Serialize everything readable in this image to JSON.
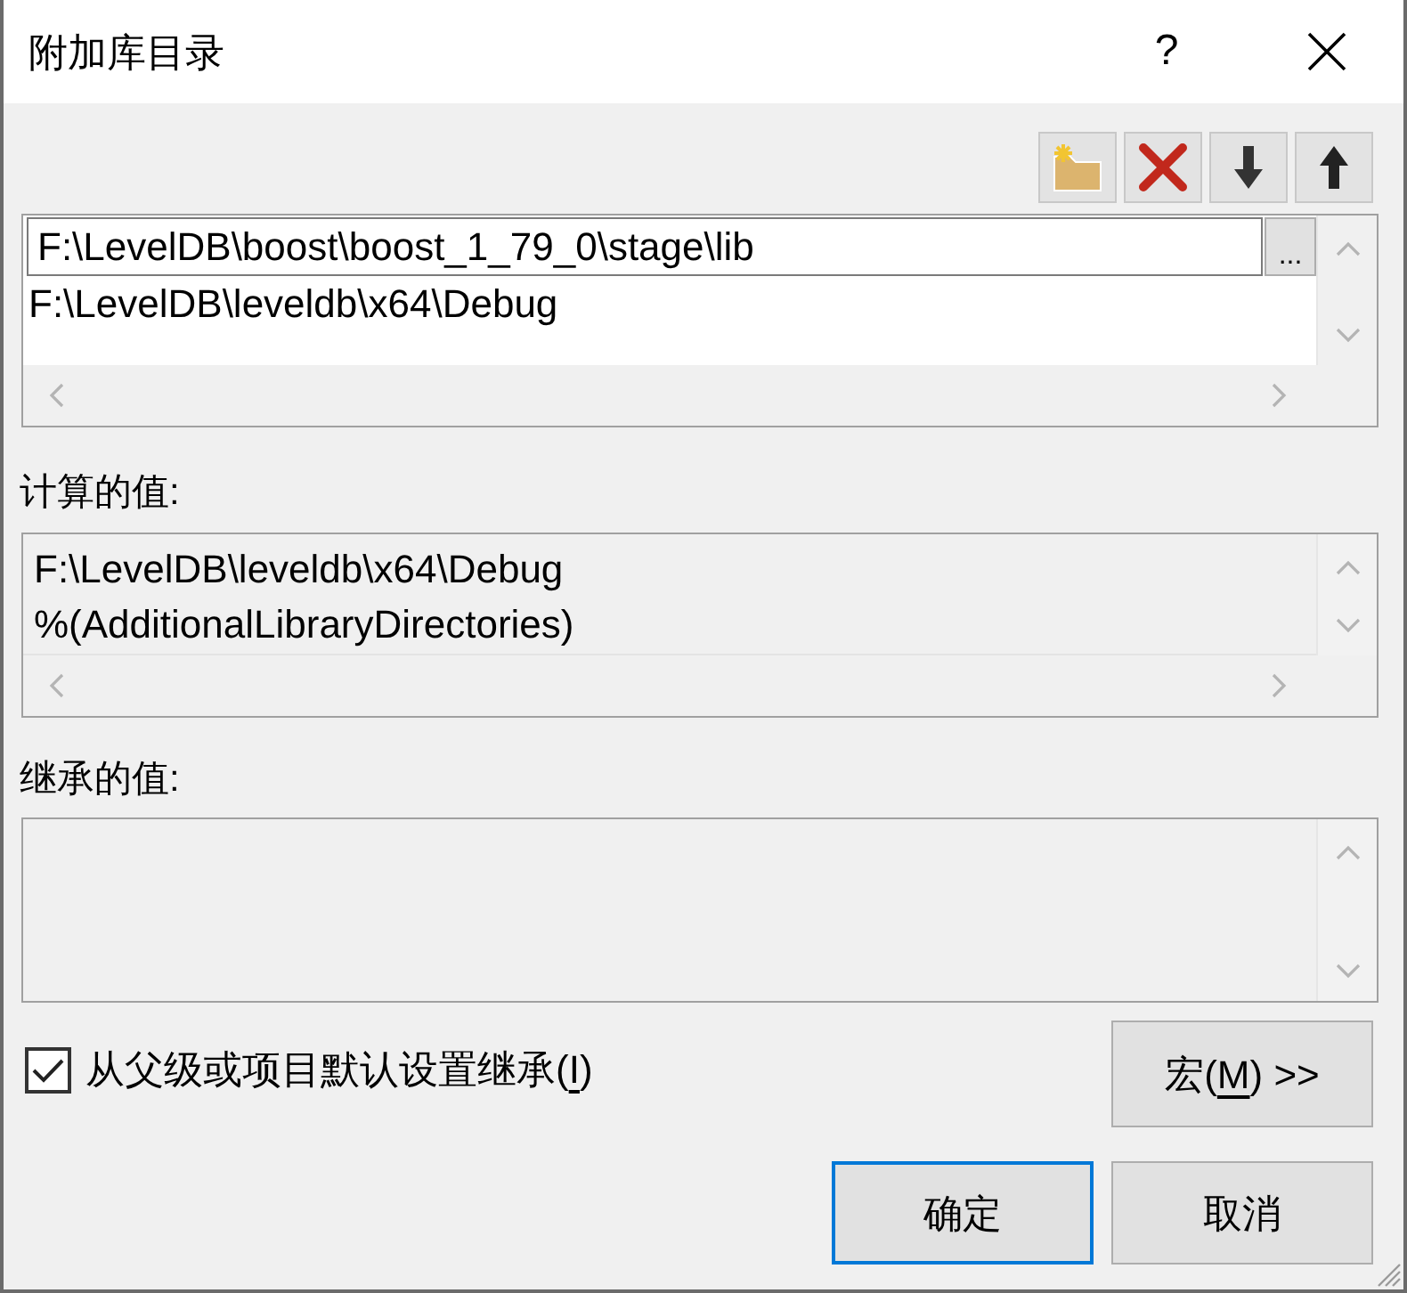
{
  "window": {
    "title": "附加库目录",
    "help_button": "?"
  },
  "directory_list": {
    "rows": [
      {
        "kind": "editing",
        "value": "F:\\LevelDB\\boost\\boost_1_79_0\\stage\\lib",
        "browse_button": "..."
      },
      {
        "kind": "text",
        "value": "F:\\LevelDB\\leveldb\\x64\\Debug"
      }
    ]
  },
  "computed_values": {
    "label": "计算的值:",
    "lines": [
      "F:\\LevelDB\\leveldb\\x64\\Debug",
      "%(AdditionalLibraryDirectories)"
    ]
  },
  "inherited_values": {
    "label": "继承的值:"
  },
  "inherit_checkbox": {
    "label_before": "从父级或项目默认设置继承(",
    "mnemonic": "I",
    "label_after": ")",
    "checked": true
  },
  "macros_button": {
    "label_before": "宏(",
    "mnemonic": "M",
    "label_after": ") >>"
  },
  "buttons": [
    {
      "label": "确定",
      "default": true
    },
    {
      "label": "取消",
      "default": false
    }
  ]
}
